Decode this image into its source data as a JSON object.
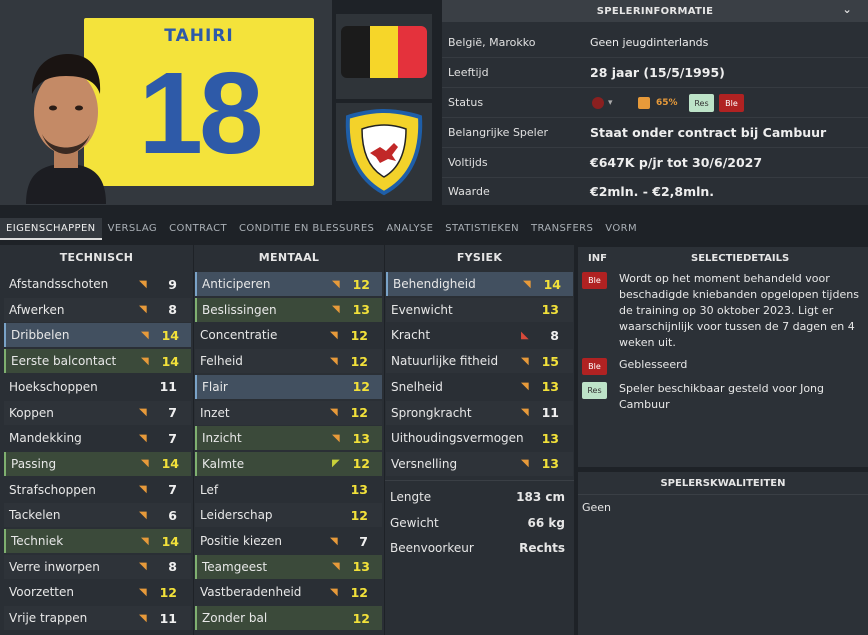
{
  "player": {
    "shirt_name": "TAHIRI",
    "shirt_number": "18"
  },
  "info": {
    "header": "SPELERINFORMATIE",
    "rows": [
      {
        "label": "België, Marokko",
        "value": "Geen jeugdinterlands"
      },
      {
        "label": "Leeftijd",
        "value": "28 jaar (15/5/1995)"
      },
      {
        "label": "Status",
        "value": ""
      },
      {
        "label": "Belangrijke Speler",
        "value": "Staat onder contract bij Cambuur"
      },
      {
        "label": "Voltijds",
        "value": "€647K p/jr tot 30/6/2027"
      },
      {
        "label": "Waarde",
        "value": "€2mln. - €2,8mln."
      }
    ],
    "status": {
      "percent": "65%",
      "badge_res": "Res",
      "badge_ble": "Ble"
    }
  },
  "tabs": [
    "EIGENSCHAPPEN",
    "VERSLAG",
    "CONTRACT",
    "CONDITIE EN BLESSURES",
    "ANALYSE",
    "STATISTIEKEN",
    "TRANSFERS",
    "VORM"
  ],
  "columns": {
    "technical": "TECHNISCH",
    "mental": "MENTAAL",
    "physical": "FYSIEK"
  },
  "technical": [
    {
      "name": "Afstandsschoten",
      "value": "9"
    },
    {
      "name": "Afwerken",
      "value": "8"
    },
    {
      "name": "Dribbelen",
      "value": "14"
    },
    {
      "name": "Eerste balcontact",
      "value": "14"
    },
    {
      "name": "Hoekschoppen",
      "value": "11"
    },
    {
      "name": "Koppen",
      "value": "7"
    },
    {
      "name": "Mandekking",
      "value": "7"
    },
    {
      "name": "Passing",
      "value": "14"
    },
    {
      "name": "Strafschoppen",
      "value": "7"
    },
    {
      "name": "Tackelen",
      "value": "6"
    },
    {
      "name": "Techniek",
      "value": "14"
    },
    {
      "name": "Verre inworpen",
      "value": "8"
    },
    {
      "name": "Voorzetten",
      "value": "12"
    },
    {
      "name": "Vrije trappen",
      "value": "11"
    }
  ],
  "mental": [
    {
      "name": "Anticiperen",
      "value": "12"
    },
    {
      "name": "Beslissingen",
      "value": "13"
    },
    {
      "name": "Concentratie",
      "value": "12"
    },
    {
      "name": "Felheid",
      "value": "12"
    },
    {
      "name": "Flair",
      "value": "12"
    },
    {
      "name": "Inzet",
      "value": "12"
    },
    {
      "name": "Inzicht",
      "value": "13"
    },
    {
      "name": "Kalmte",
      "value": "12"
    },
    {
      "name": "Lef",
      "value": "13"
    },
    {
      "name": "Leiderschap",
      "value": "12"
    },
    {
      "name": "Positie kiezen",
      "value": "7"
    },
    {
      "name": "Teamgeest",
      "value": "13"
    },
    {
      "name": "Vastberadenheid",
      "value": "12"
    },
    {
      "name": "Zonder bal",
      "value": "12"
    }
  ],
  "physical": [
    {
      "name": "Behendigheid",
      "value": "14"
    },
    {
      "name": "Evenwicht",
      "value": "13"
    },
    {
      "name": "Kracht",
      "value": "8"
    },
    {
      "name": "Natuurlijke fitheid",
      "value": "15"
    },
    {
      "name": "Snelheid",
      "value": "13"
    },
    {
      "name": "Sprongkracht",
      "value": "11"
    },
    {
      "name": "Uithoudingsvermogen",
      "value": "13"
    },
    {
      "name": "Versnelling",
      "value": "13"
    }
  ],
  "physical_extra": [
    {
      "label": "Lengte",
      "value": "183 cm"
    },
    {
      "label": "Gewicht",
      "value": "66 kg"
    },
    {
      "label": "Beenvoorkeur",
      "value": "Rechts"
    }
  ],
  "inf": {
    "header_inf": "INF",
    "header_details": "SELECTIEDETAILS",
    "items": [
      {
        "badge": "Ble",
        "text": "Wordt op het moment behandeld voor beschadigde kniebanden opgelopen tijdens de training op 30 oktober 2023. Ligt er waarschijnlijk voor tussen de 7 dagen en 4 weken uit."
      },
      {
        "badge": "Ble",
        "text": "Geblesseerd"
      },
      {
        "badge": "Res",
        "text": "Speler beschikbaar gesteld voor Jong Cambuur"
      }
    ]
  },
  "qualities": {
    "header": "SPELERSKWALITEITEN",
    "text": "Geen"
  },
  "colors": {
    "shirt_yellow": "#f4e33b",
    "shirt_blue": "#2e5aa8",
    "flag_black": "#1b1b1b",
    "flag_yellow": "#f6d629",
    "flag_red": "#e4323c",
    "injury_red": "#b02222",
    "attr_yellow": "#f2e13a"
  }
}
